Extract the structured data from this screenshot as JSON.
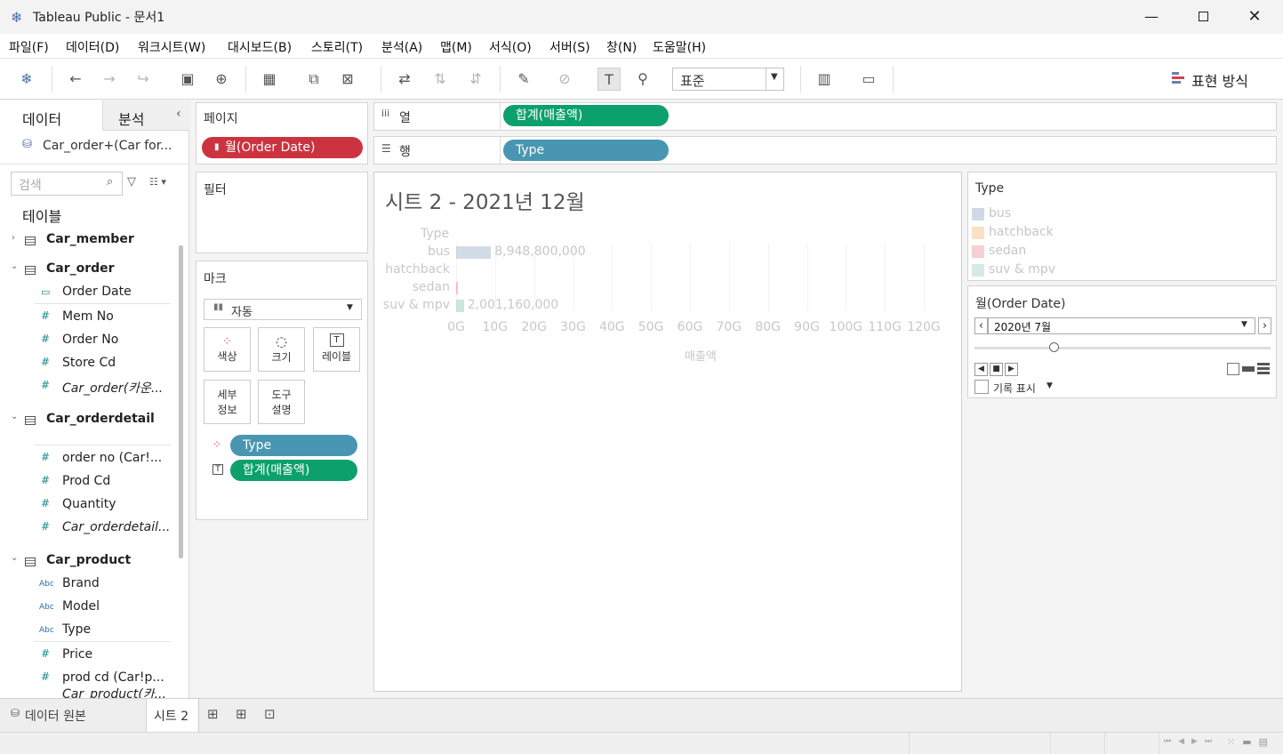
{
  "window": {
    "title": "Tableau Public - 문서1"
  },
  "menu": [
    "파일(F)",
    "데이터(D)",
    "워크시트(W)",
    "대시보드(B)",
    "스토리(T)",
    "분석(A)",
    "맵(M)",
    "서식(O)",
    "서버(S)",
    "창(N)",
    "도움말(H)"
  ],
  "toolbar": {
    "fit_select": "표준",
    "show_me": "표현 방식"
  },
  "left_pane": {
    "tab_data": "데이터",
    "tab_analysis": "분석",
    "datasource": "Car_order+(Car for...",
    "search_placeholder": "검색",
    "tables_heading": "테이블",
    "tables": [
      {
        "name": "Car_member"
      },
      {
        "name": "Car_order",
        "fields": [
          "Order Date",
          "Mem No",
          "Order No",
          "Store Cd",
          "Car_order(카운..."
        ]
      },
      {
        "name": "Car_orderdetail",
        "fields": [
          "order no (Car!...",
          "Prod Cd",
          "Quantity",
          "Car_orderdetail..."
        ]
      },
      {
        "name": "Car_product",
        "fields": [
          "Brand",
          "Model",
          "Type",
          "Price",
          "prod cd (Car!p...",
          "Car_product(카..."
        ]
      }
    ]
  },
  "shelves": {
    "pages_label": "페이지",
    "pages_pill": "월(Order Date)",
    "filters_label": "필터",
    "marks_label": "마크",
    "marks_type": "자동",
    "mark_buttons": [
      "색상",
      "크기",
      "레이블",
      "세부\n정보",
      "도구\n설명"
    ],
    "mark_pills": [
      "Type",
      "합계(매출액)"
    ],
    "columns_label": "열",
    "columns_pill": "합계(매출액)",
    "rows_label": "행",
    "rows_pill": "Type"
  },
  "chart_data": {
    "type": "bar",
    "title": "시트 2 - 2021년 12월",
    "ylabel": "Type",
    "xlabel": "매출액",
    "categories": [
      "bus",
      "hatchback",
      "sedan",
      "suv & mpv"
    ],
    "values": [
      8948800000,
      0,
      0,
      2001160000
    ],
    "value_labels": [
      "8,948,800,000",
      "",
      "",
      "2,001,160,000"
    ],
    "xticks": [
      "0G",
      "10G",
      "20G",
      "30G",
      "40G",
      "50G",
      "60G",
      "70G",
      "80G",
      "90G",
      "100G",
      "110G",
      "120G"
    ],
    "xlim": [
      0,
      120000000000
    ],
    "colors": [
      "#b4c3d8",
      "#f6c99a",
      "#ef9aa3",
      "#a9d3cf"
    ]
  },
  "legend": {
    "title": "Type",
    "items": [
      {
        "label": "bus",
        "color": "#cfd9e6"
      },
      {
        "label": "hatchback",
        "color": "#f9e0c6"
      },
      {
        "label": "sedan",
        "color": "#f6d0d4"
      },
      {
        "label": "suv & mpv",
        "color": "#d6e9e7"
      }
    ]
  },
  "page_control": {
    "title": "월(Order Date)",
    "value": "2020년 7월",
    "history_label": "기록 표시"
  },
  "bottom_tabs": {
    "datasource": "데이터 원본",
    "sheet": "시트 2"
  }
}
